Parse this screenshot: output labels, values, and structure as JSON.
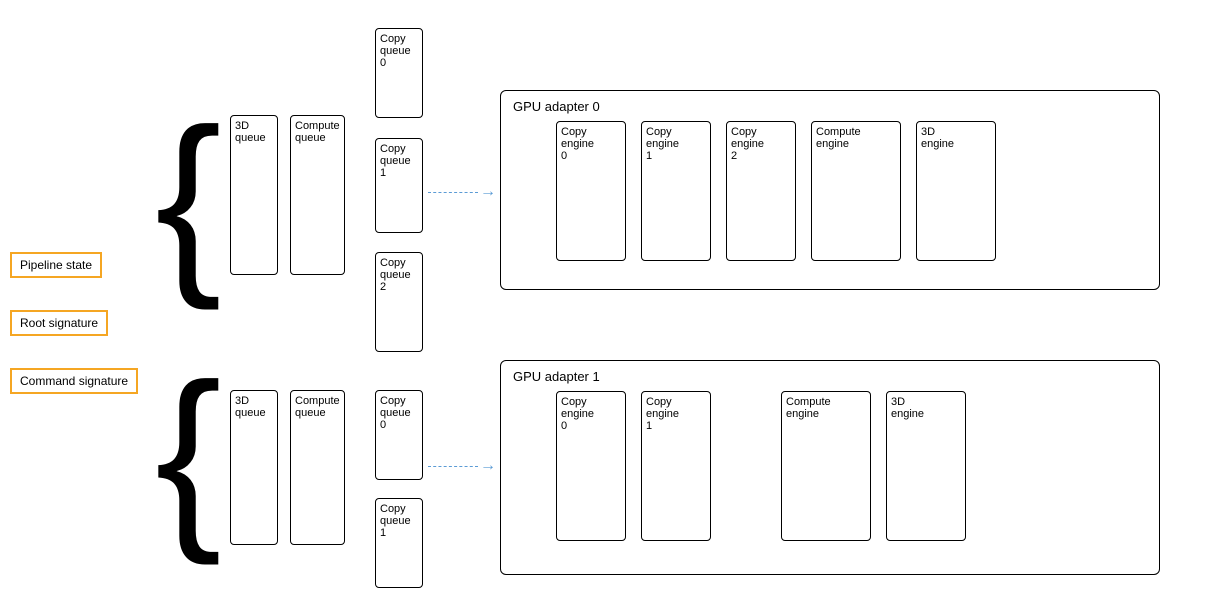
{
  "labels": {
    "pipeline_state": "Pipeline state",
    "root_signature": "Root signature",
    "command_signature": "Command signature"
  },
  "gpu_adapter_0": {
    "title": "GPU adapter 0",
    "engines": [
      {
        "label": "Copy\nengine\n0"
      },
      {
        "label": "Copy\nengine\n1"
      },
      {
        "label": "Copy\nengine\n2"
      },
      {
        "label": "Compute\nengine"
      },
      {
        "label": "3D\nengine"
      }
    ]
  },
  "gpu_adapter_1": {
    "title": "GPU adapter 1",
    "engines": [
      {
        "label": "Copy\nengine\n0"
      },
      {
        "label": "Copy\nengine\n1"
      },
      {
        "label": "Compute\nengine"
      },
      {
        "label": "3D\nengine"
      }
    ]
  },
  "adapter0_queues_left": [
    {
      "label": "3D\nqueue"
    },
    {
      "label": "Compute\nqueue"
    }
  ],
  "adapter0_copy_queues": [
    {
      "label": "Copy\nqueue\n0"
    },
    {
      "label": "Copy\nqueue\n1"
    },
    {
      "label": "Copy\nqueue\n2"
    }
  ],
  "adapter1_queues_left": [
    {
      "label": "3D\nqueue"
    },
    {
      "label": "Compute\nqueue"
    }
  ],
  "adapter1_copy_queues": [
    {
      "label": "Copy\nqueue\n0"
    },
    {
      "label": "Copy\nqueue\n1"
    }
  ]
}
